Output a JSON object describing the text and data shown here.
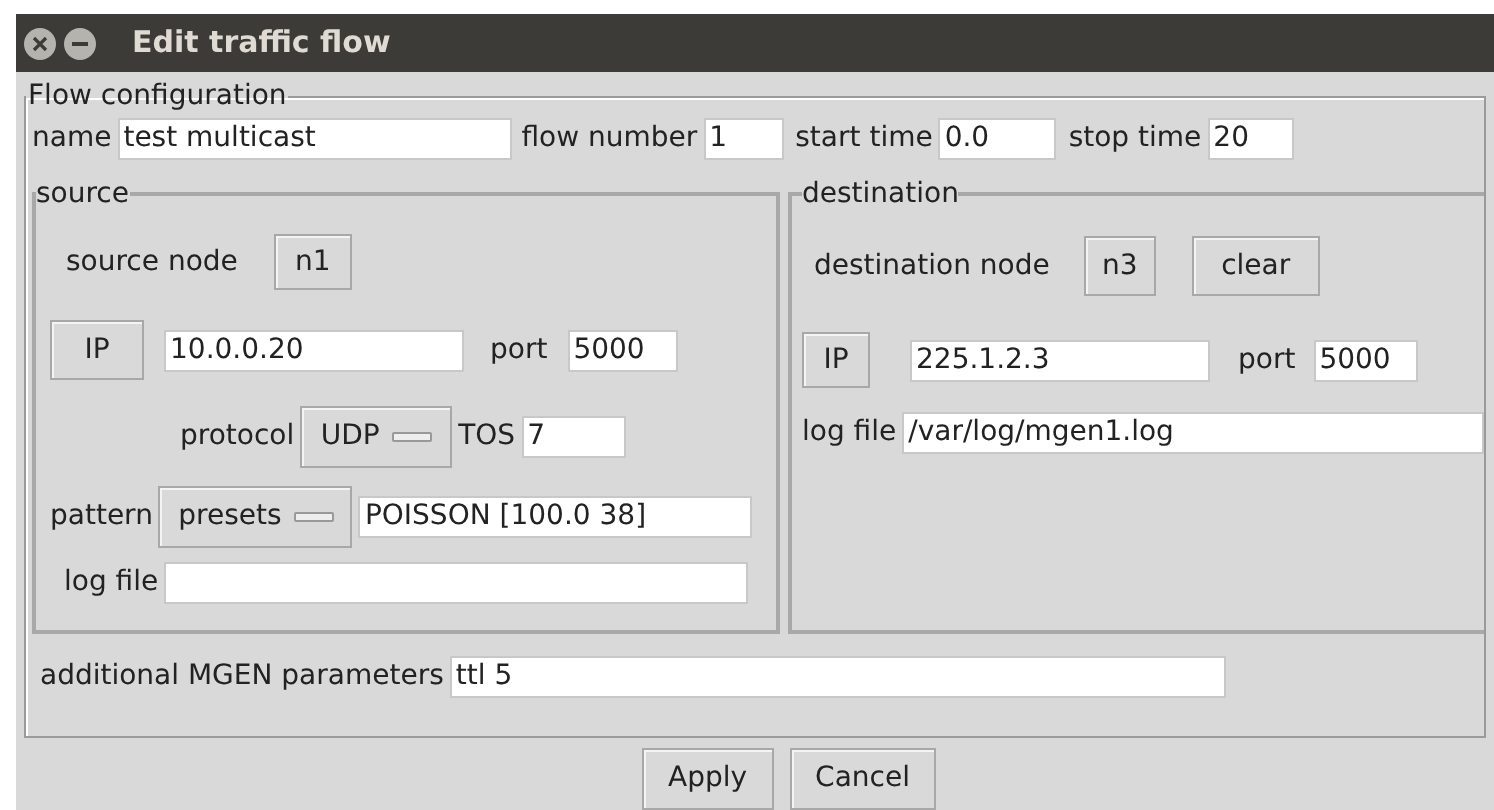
{
  "window": {
    "title": "Edit traffic flow"
  },
  "flow_configuration": {
    "title": "Flow configuration",
    "name": {
      "label": "name",
      "value": "test multicast"
    },
    "flow_number": {
      "label": "flow number",
      "value": "1"
    },
    "start_time": {
      "label": "start time",
      "value": "0.0"
    },
    "stop_time": {
      "label": "stop time",
      "value": "20"
    }
  },
  "source": {
    "title": "source",
    "node_label": "source node",
    "node_button": "n1",
    "ip_button": "IP",
    "ip": "10.0.0.20",
    "port_label": "port",
    "port": "5000",
    "protocol_label": "protocol",
    "protocol": "UDP",
    "tos_label": "TOS",
    "tos": "7",
    "pattern_label": "pattern",
    "pattern_menu": "presets",
    "pattern": "POISSON [100.0 38]",
    "log_label": "log file"
  },
  "destination": {
    "title": "destination",
    "node_label": "destination node",
    "node_button": "n3",
    "clear_button": "clear",
    "ip_button": "IP",
    "ip": "225.1.2.3",
    "port_label": "port",
    "port": "5000",
    "log_label": "log file",
    "log_file": "/var/log/mgen1.log"
  },
  "additional": {
    "label": "additional MGEN parameters",
    "value": "ttl 5"
  },
  "buttons": [
    "Apply",
    "Cancel"
  ]
}
